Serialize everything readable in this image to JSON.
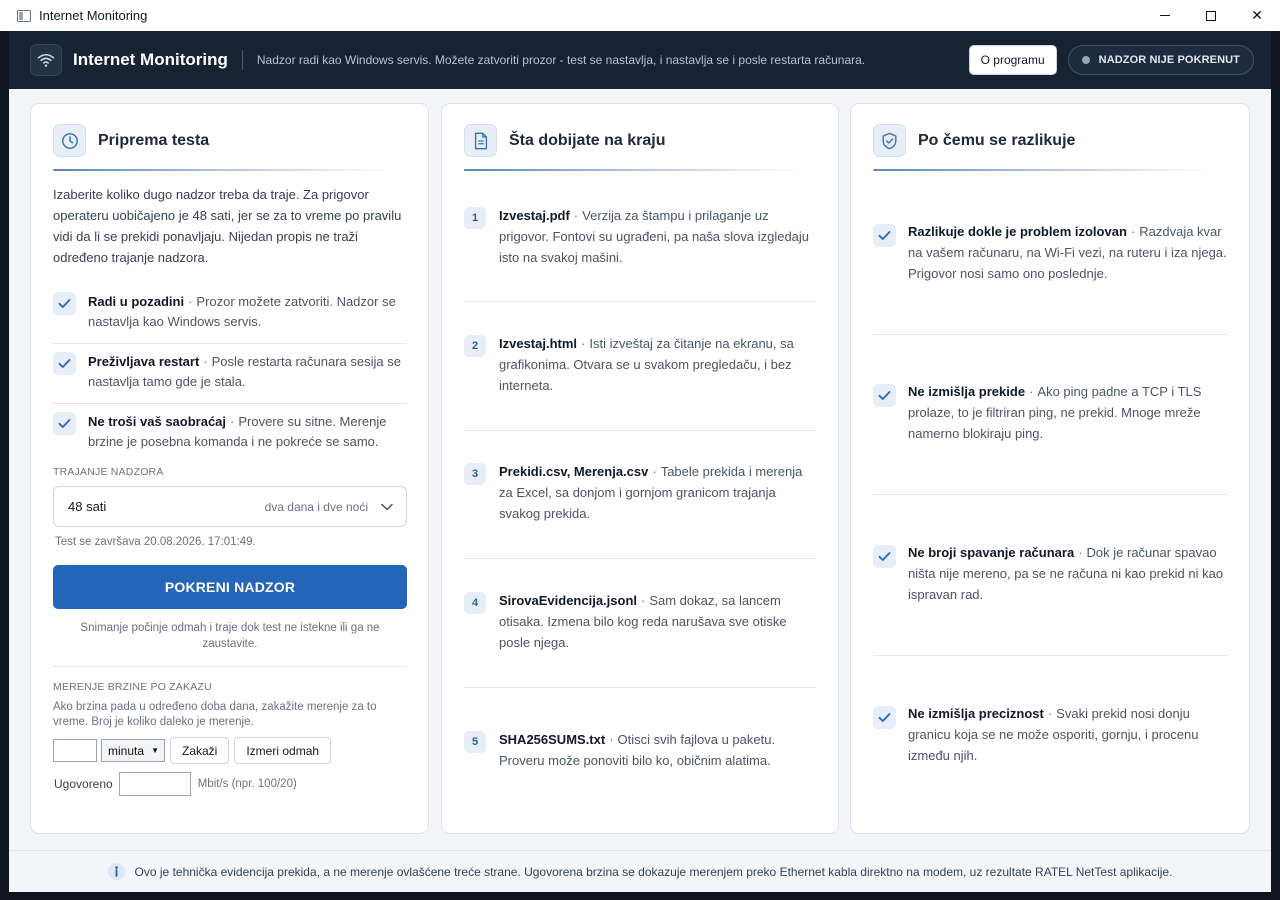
{
  "window": {
    "title": "Internet Monitoring",
    "minimize": "—",
    "close": "✕"
  },
  "header": {
    "title": "Internet Monitoring",
    "subtitle": "Nadzor radi kao Windows servis. Možete zatvoriti prozor - test se nastavlja, i nastavlja se i posle restarta računara.",
    "about_label": "O programu",
    "status_label": "NADZOR NIJE POKRENUT",
    "status_color": "#9ca3af"
  },
  "prep": {
    "title": "Priprema testa",
    "intro": "Izaberite koliko dugo nadzor treba da traje. Za prigovor operateru uobičajeno je 48 sati, jer se za to vreme po pravilu vidi da li se prekidi ponavljaju. Nijedan propis ne traži određeno trajanje nadzora.",
    "features": [
      {
        "title": "Radi u pozadini",
        "desc": "Prozor možete zatvoriti. Nadzor se nastavlja kao Windows servis."
      },
      {
        "title": "Preživljava restart",
        "desc": "Posle restarta računara sesija se nastavlja tamo gde je stala."
      },
      {
        "title": "Ne troši vaš saobraćaj",
        "desc": "Provere su sitne. Merenje brzine je posebna komanda i ne pokreće se samo."
      }
    ],
    "separator": "·",
    "duration_label": "TRAJANJE NADZORA",
    "duration_value": "48 sati",
    "duration_hint": "dva dana i dve noći",
    "ends_text": "Test se završava 20.08.2026. 17:01:49.",
    "start_label": "POKRENI NADZOR",
    "start_note": "Snimanje počinje odmah i traje dok test ne istekne ili ga ne zaustavite.",
    "speed_label": "MERENJE BRZINE PO ZAKAZU",
    "speed_desc": "Ako brzina pada u određeno doba dana, zakažite merenje za to vreme. Broj je koliko daleko je merenje.",
    "unit_value": "minuta",
    "schedule_label": "Zakaži",
    "measure_now_label": "Izmeri odmah",
    "agreed_label": "Ugovoreno",
    "agreed_unit": "Mbit/s  (npr. 100/20)"
  },
  "output": {
    "title": "Šta dobijate na kraju",
    "files": [
      {
        "num": "1",
        "name": "Izvestaj.pdf",
        "desc": "Verzija za štampu i prilaganje uz prigovor. Fontovi su ugrađeni, pa naša slova izgledaju isto na svakoj mašini."
      },
      {
        "num": "2",
        "name": "Izvestaj.html",
        "desc": "Isti izveštaj za čitanje na ekranu, sa grafikonima. Otvara se u svakom pregledaču, i bez interneta."
      },
      {
        "num": "3",
        "name": "Prekidi.csv, Merenja.csv",
        "desc": "Tabele prekida i merenja za Excel, sa donjom i gornjom granicom trajanja svakog prekida."
      },
      {
        "num": "4",
        "name": "SirovaEvidencija.jsonl",
        "desc": "Sam dokaz, sa lancem otisaka. Izmena bilo kog reda narušava sve otiske posle njega."
      },
      {
        "num": "5",
        "name": "SHA256SUMS.txt",
        "desc": "Otisci svih fajlova u paketu. Proveru može ponoviti bilo ko, običnim alatima."
      }
    ]
  },
  "diff": {
    "title": "Po čemu se razlikuje",
    "items": [
      {
        "title": "Razlikuje dokle je problem izolovan",
        "desc": "Razdvaja kvar na vašem računaru, na Wi-Fi vezi, na ruteru i iza njega. Prigovor nosi samo ono poslednje."
      },
      {
        "title": "Ne izmišlja prekide",
        "desc": "Ako ping padne a TCP i TLS prolaze, to je filtriran ping, ne prekid. Mnoge mreže namerno blokiraju ping."
      },
      {
        "title": "Ne broji spavanje računara",
        "desc": "Dok je računar spavao ništa nije mereno, pa se ne računa ni kao prekid ni kao ispravan rad."
      },
      {
        "title": "Ne izmišlja preciznost",
        "desc": "Svaki prekid nosi donju granicu koja se ne može osporiti, gornju, i procenu između njih."
      }
    ]
  },
  "footer": {
    "text": "Ovo je tehnička evidencija prekida, a ne merenje ovlašćene treće strane. Ugovorena brzina se dokazuje merenjem preko Ethernet kabla direktno na modem, uz rezultate RATEL NetTest aplikacije."
  },
  "colors": {
    "accent": "#2366b8",
    "header_bg": "#172233",
    "check": "#2e6bbf"
  }
}
